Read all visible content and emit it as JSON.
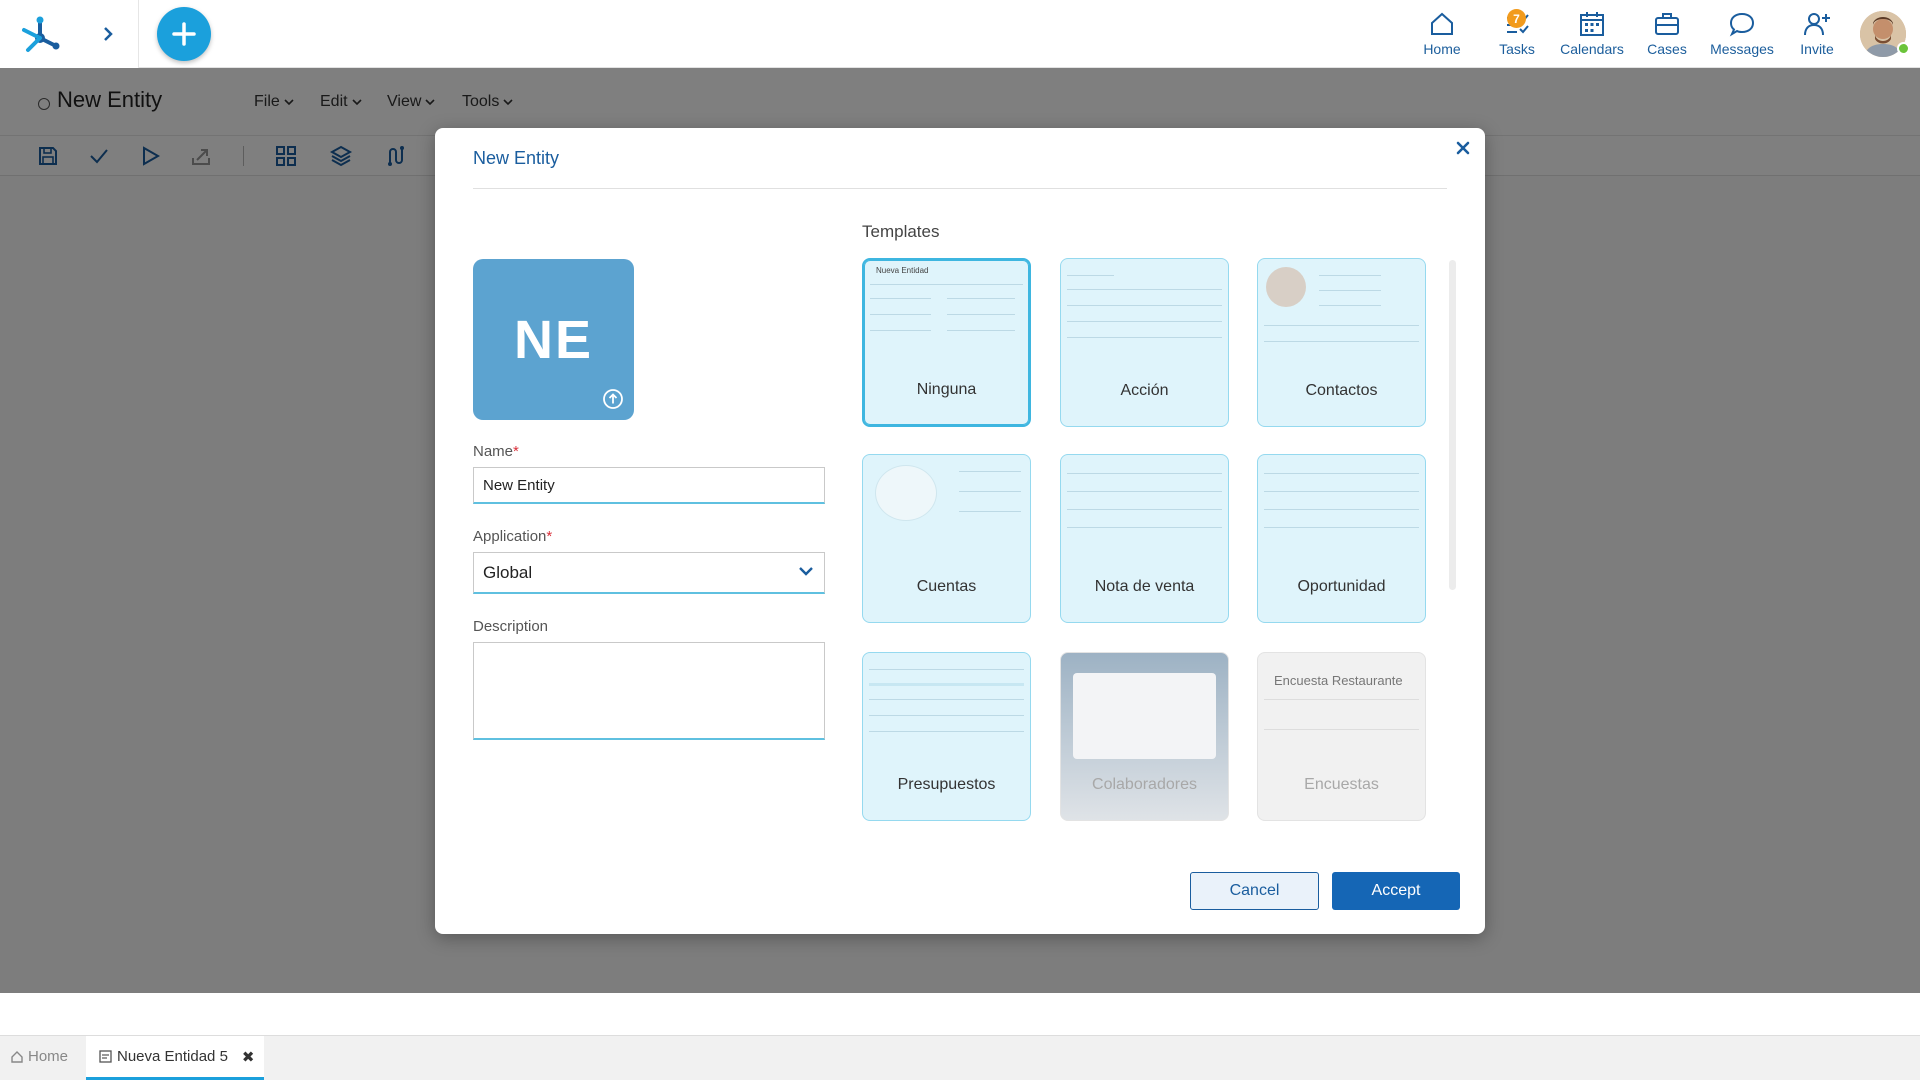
{
  "topbar": {
    "nav": [
      {
        "label": "Home",
        "icon": "home-icon"
      },
      {
        "label": "Tasks",
        "icon": "tasks-icon",
        "badge": "7"
      },
      {
        "label": "Calendars",
        "icon": "calendar-icon"
      },
      {
        "label": "Cases",
        "icon": "briefcase-icon"
      },
      {
        "label": "Messages",
        "icon": "chat-icon"
      },
      {
        "label": "Invite",
        "icon": "add-user-icon"
      }
    ],
    "accent_color": "#1ba0dc",
    "badge_color": "#f29b1d"
  },
  "editor": {
    "title": "New Entity",
    "menus": [
      "File",
      "Edit",
      "View",
      "Tools"
    ]
  },
  "dialog": {
    "title": "New Entity",
    "initials": "NE",
    "name_label": "Name",
    "name_value": "New Entity",
    "application_label": "Application",
    "application_value": "Global",
    "description_label": "Description",
    "description_value": "",
    "required_mark": "*",
    "templates_title": "Templates",
    "templates": [
      {
        "label": "Ninguna",
        "selected": true,
        "preview_title": "Nueva Entidad"
      },
      {
        "label": "Acción"
      },
      {
        "label": "Contactos"
      },
      {
        "label": "Cuentas"
      },
      {
        "label": "Nota de venta"
      },
      {
        "label": "Oportunidad"
      },
      {
        "label": "Presupuestos"
      },
      {
        "label": "Colaboradores",
        "muted": true
      },
      {
        "label": "Encuestas",
        "muted": true,
        "preview_title": "Encuesta Restaurante"
      }
    ],
    "cancel_label": "Cancel",
    "accept_label": "Accept"
  },
  "bottom_tabs": {
    "home_label": "Home",
    "active_tab_label": "Nueva Entidad 5"
  }
}
